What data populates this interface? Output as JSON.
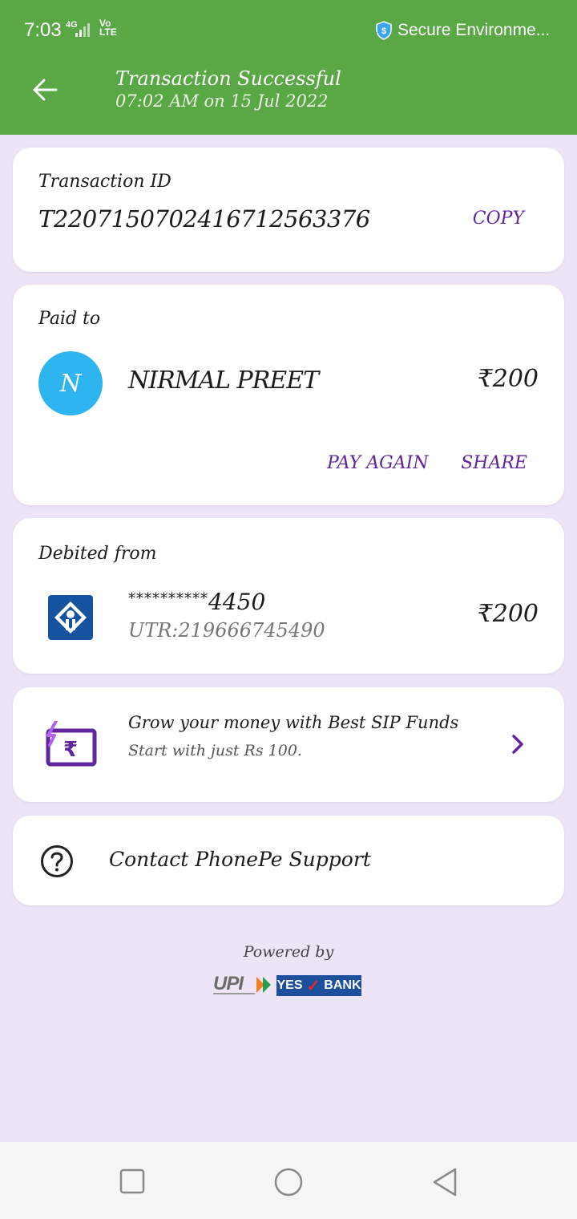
{
  "status_bar": {
    "time": "7:03",
    "network": "4G",
    "volte": "Vo\nLTE",
    "secure_text": "Secure Environme..."
  },
  "header": {
    "title": "Transaction Successful",
    "subtitle": "07:02 AM on 15 Jul 2022",
    "back_icon": "arrow-left-icon"
  },
  "transaction": {
    "label": "Transaction ID",
    "id": "T2207150702416712563376",
    "copy_label": "COPY"
  },
  "paid_to": {
    "label": "Paid to",
    "avatar_initial": "N",
    "name": "NIRMAL PREET",
    "amount": "₹200",
    "pay_again_label": "PAY AGAIN",
    "share_label": "SHARE"
  },
  "debited": {
    "label": "Debited from",
    "account_mask": "**********",
    "account_last": "4450",
    "utr": "UTR:219666745490",
    "amount": "₹200"
  },
  "sip": {
    "title": "Grow your money with Best SIP Funds",
    "subtitle": "Start with just Rs 100."
  },
  "support": {
    "label": "Contact PhonePe Support"
  },
  "footer": {
    "powered_by": "Powered by",
    "bank_yes": "YES",
    "bank_name": "BANK"
  },
  "colors": {
    "header_green": "#5aa745",
    "accent_purple": "#5f259f",
    "avatar_blue": "#2eb4ef",
    "page_bg": "#ede4f6"
  }
}
